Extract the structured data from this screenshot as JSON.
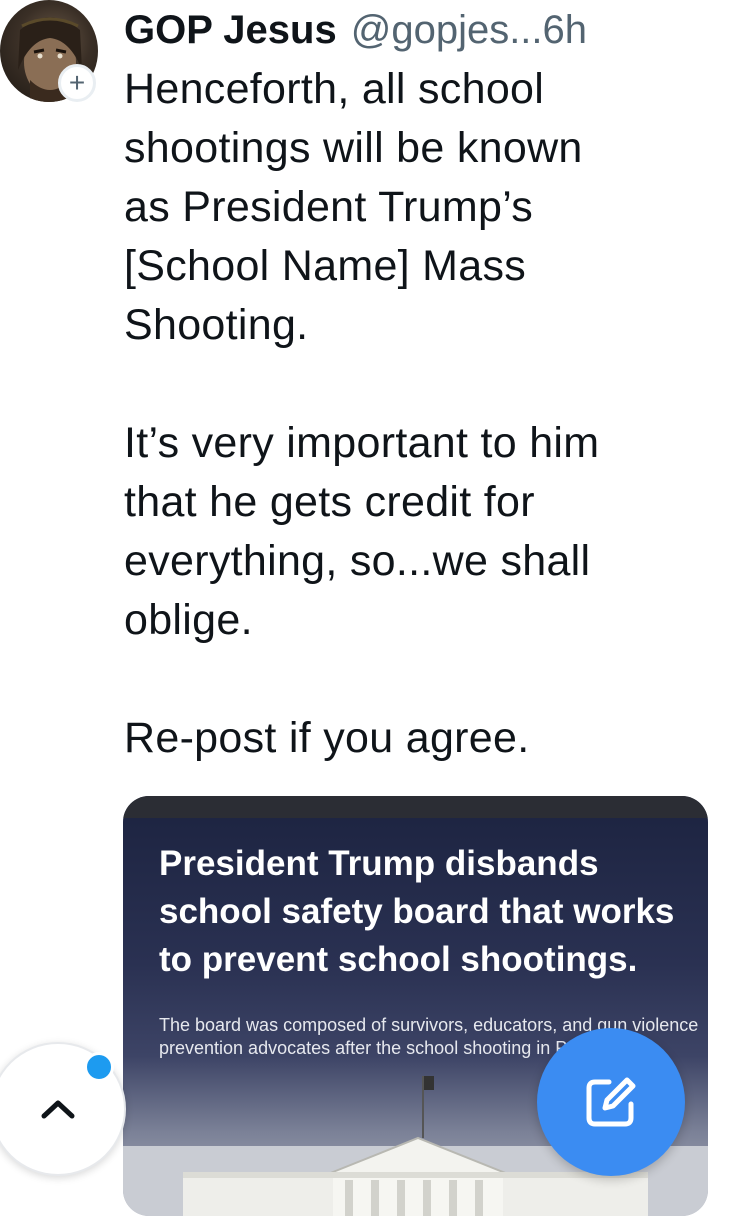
{
  "post": {
    "author": {
      "display_name": "GOP Jesus",
      "handle": "@gopjes...",
      "timestamp": "6h",
      "avatar_icon": "portrait-avatar",
      "follow_icon": "plus-icon",
      "follow_symbol": "+"
    },
    "text_lines": [
      "Henceforth, all school",
      "shootings will be known",
      "as President Trump’s",
      "[School Name] Mass",
      "Shooting.",
      "",
      "It’s very important to him",
      "that he gets credit for",
      "everything, so...we shall",
      "oblige.",
      "",
      "Re-post if you agree."
    ],
    "media": {
      "headline_lines": [
        "President Trump disbands",
        "school safety board that works",
        "to prevent school shootings."
      ],
      "subhead_lines": [
        "The board was composed of survivors, educators, and gun violence",
        "prevention advocates after the school shooting in P"
      ]
    }
  },
  "floating": {
    "scroll_top_icon": "chevron-up-icon",
    "compose_icon": "compose-icon",
    "accent_color": "#1d9bf0"
  }
}
